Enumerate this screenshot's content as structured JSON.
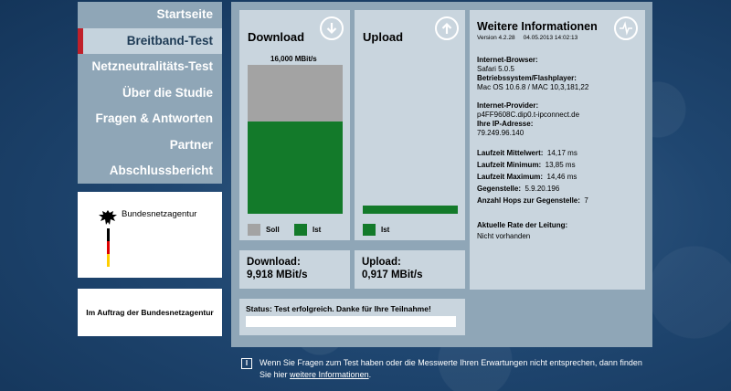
{
  "nav": {
    "items": [
      {
        "label": "Startseite"
      },
      {
        "label": "Breitband-Test"
      },
      {
        "label": "Netzneutralitäts-Test"
      },
      {
        "label": "Über die Studie"
      },
      {
        "label": "Fragen & Antworten"
      },
      {
        "label": "Partner"
      },
      {
        "label": "Abschlussbericht"
      }
    ],
    "active_index": 1
  },
  "logo": {
    "name": "Bundesnetzagentur"
  },
  "auftrag": {
    "text": "Im Auftrag der Bundesnetzagentur"
  },
  "download": {
    "title": "Download",
    "soll_label": "16,000 MBit/s",
    "soll_fraction": 1.0,
    "ist_fraction": 0.62,
    "legend_soll": "Soll",
    "legend_ist": "Ist",
    "result_label": "Download:",
    "result_value": "9,918 MBit/s"
  },
  "upload": {
    "title": "Upload",
    "ist_fraction": 0.057,
    "legend_ist": "Ist",
    "result_label": "Upload:",
    "result_value": "0,917 MBit/s"
  },
  "info": {
    "title": "Weitere Informationen",
    "version": "Version 4.2.28",
    "date": "04.05.2013 14:02:13",
    "browser_label": "Internet-Browser:",
    "browser_value": "Safari 5.0.5",
    "system_label": "Betriebssystem/Flashplayer:",
    "system_value": "Mac OS 10.6.8 / MAC 10,3,181,22",
    "provider_label": "Internet-Provider:",
    "provider_value": "p4FF9608C.dip0.t-ipconnect.de",
    "ip_label": "Ihre IP-Adresse:",
    "ip_value": "79.249.96.140",
    "avg_label": "Laufzeit Mittelwert:",
    "avg_value": "14,17 ms",
    "min_label": "Laufzeit Minimum:",
    "min_value": "13,85 ms",
    "max_label": "Laufzeit Maximum:",
    "max_value": "14,46 ms",
    "peer_label": "Gegenstelle:",
    "peer_value": "5.9.20.196",
    "hops_label": "Anzahl Hops zur Gegenstelle:",
    "hops_value": "7",
    "rate_label": "Aktuelle Rate der Leitung:",
    "rate_value": "Nicht vorhanden"
  },
  "status": {
    "text": "Status: Test erfolgreich. Danke für Ihre Teilnahme!"
  },
  "footer": {
    "icon": "I",
    "text": "Wenn Sie Fragen zum Test haben oder die Messwerte Ihren Erwartungen nicht entsprechen, dann finden Sie hier",
    "link": "weitere Informationen",
    "end": "."
  },
  "colors": {
    "ist": "#137a2a",
    "soll": "#a3a3a3",
    "active_marker": "#c0202a"
  }
}
